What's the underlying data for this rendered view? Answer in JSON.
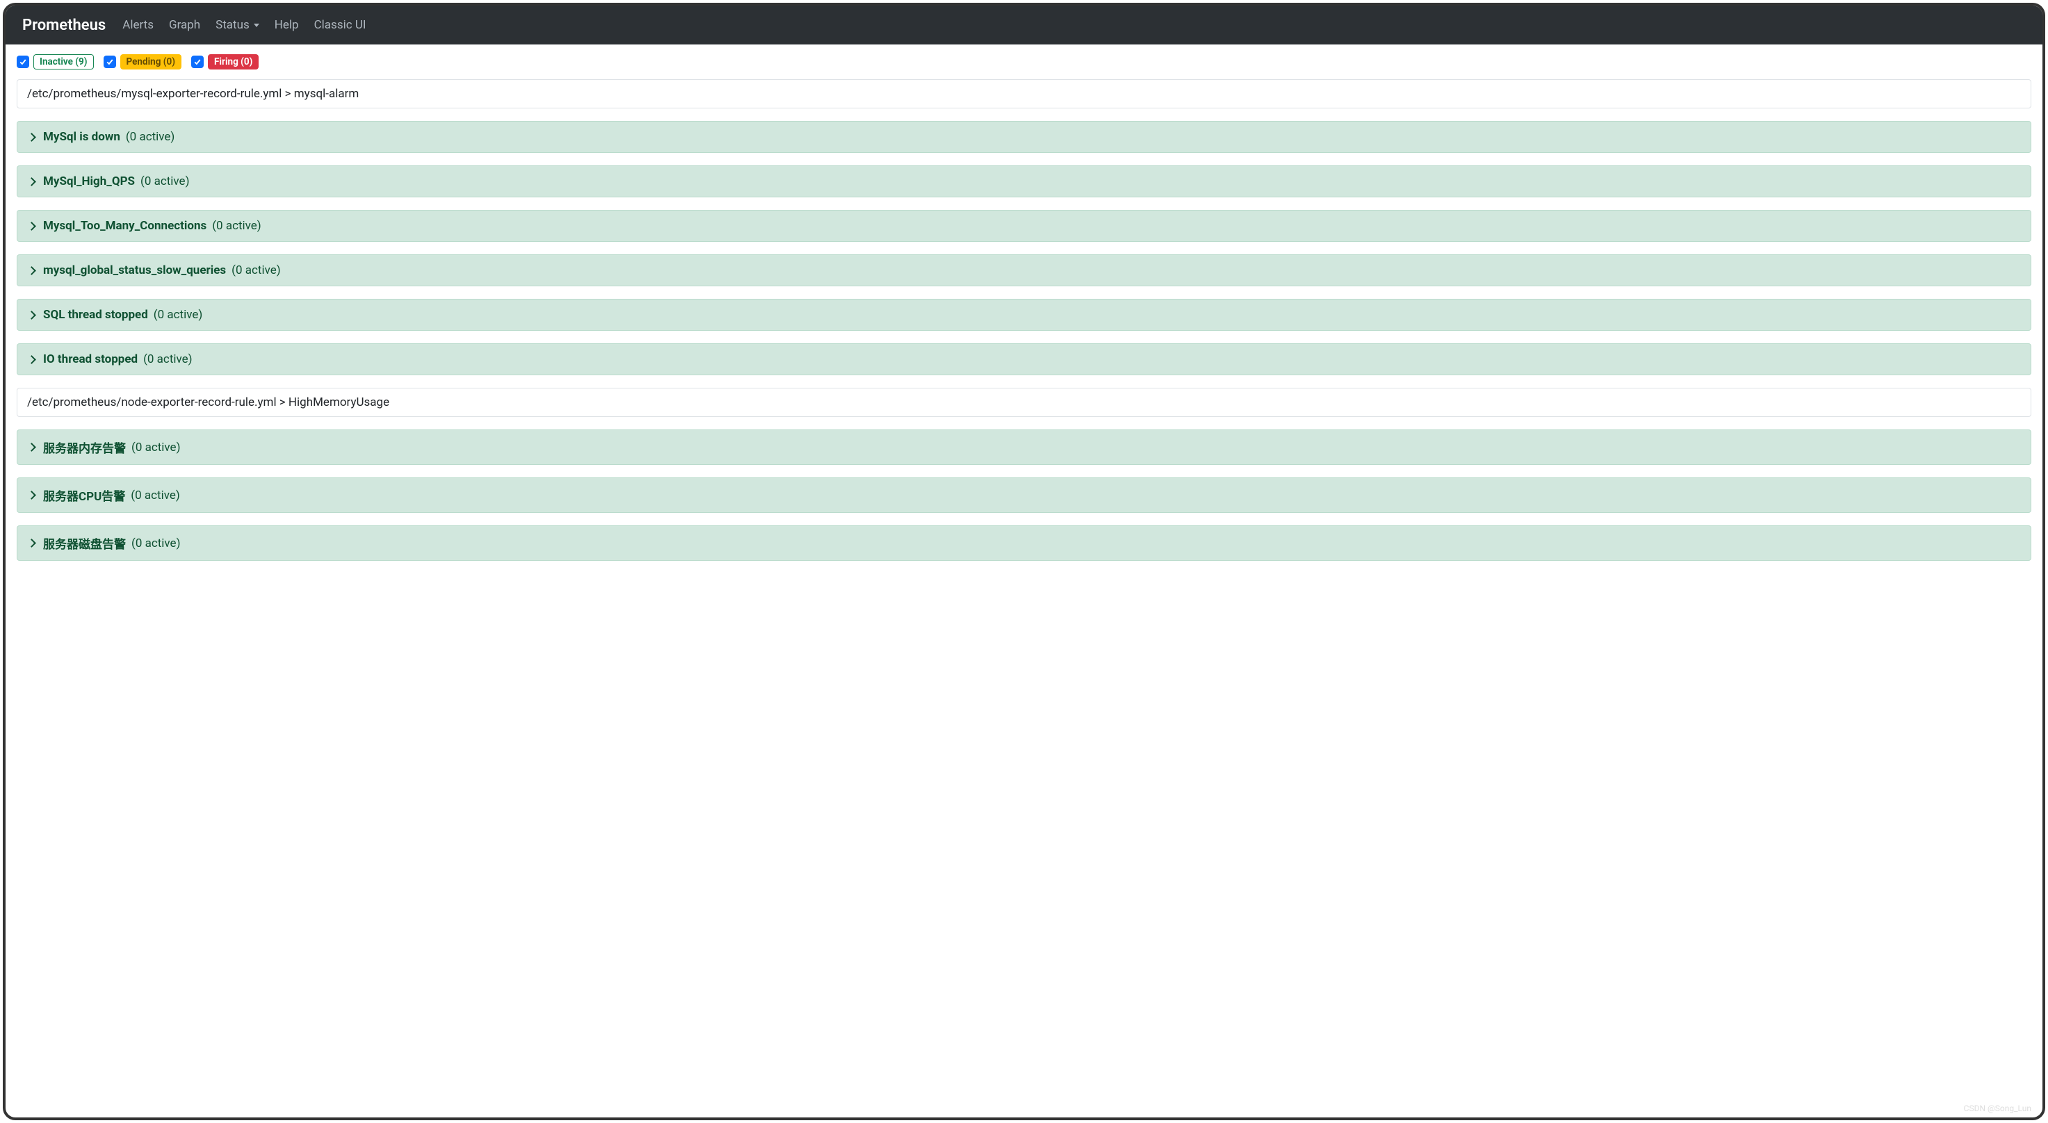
{
  "navbar": {
    "brand": "Prometheus",
    "links": {
      "alerts": "Alerts",
      "graph": "Graph",
      "status": "Status",
      "help": "Help",
      "classic": "Classic UI"
    }
  },
  "filters": {
    "inactive": "Inactive (9)",
    "pending": "Pending (0)",
    "firing": "Firing (0)"
  },
  "groups": [
    {
      "header": "/etc/prometheus/mysql-exporter-record-rule.yml > mysql-alarm",
      "rules": [
        {
          "name": "MySql is down",
          "active": "(0 active)"
        },
        {
          "name": "MySql_High_QPS",
          "active": "(0 active)"
        },
        {
          "name": "Mysql_Too_Many_Connections",
          "active": "(0 active)"
        },
        {
          "name": "mysql_global_status_slow_queries",
          "active": "(0 active)"
        },
        {
          "name": "SQL thread stopped",
          "active": "(0 active)"
        },
        {
          "name": "IO thread stopped",
          "active": "(0 active)"
        }
      ]
    },
    {
      "header": "/etc/prometheus/node-exporter-record-rule.yml > HighMemoryUsage",
      "rules": [
        {
          "name": "服务器内存告警",
          "active": "(0 active)"
        },
        {
          "name": "服务器CPU告警",
          "active": "(0 active)"
        },
        {
          "name": "服务器磁盘告警",
          "active": "(0 active)"
        }
      ]
    }
  ],
  "watermark": "CSDN @Song_Lun"
}
